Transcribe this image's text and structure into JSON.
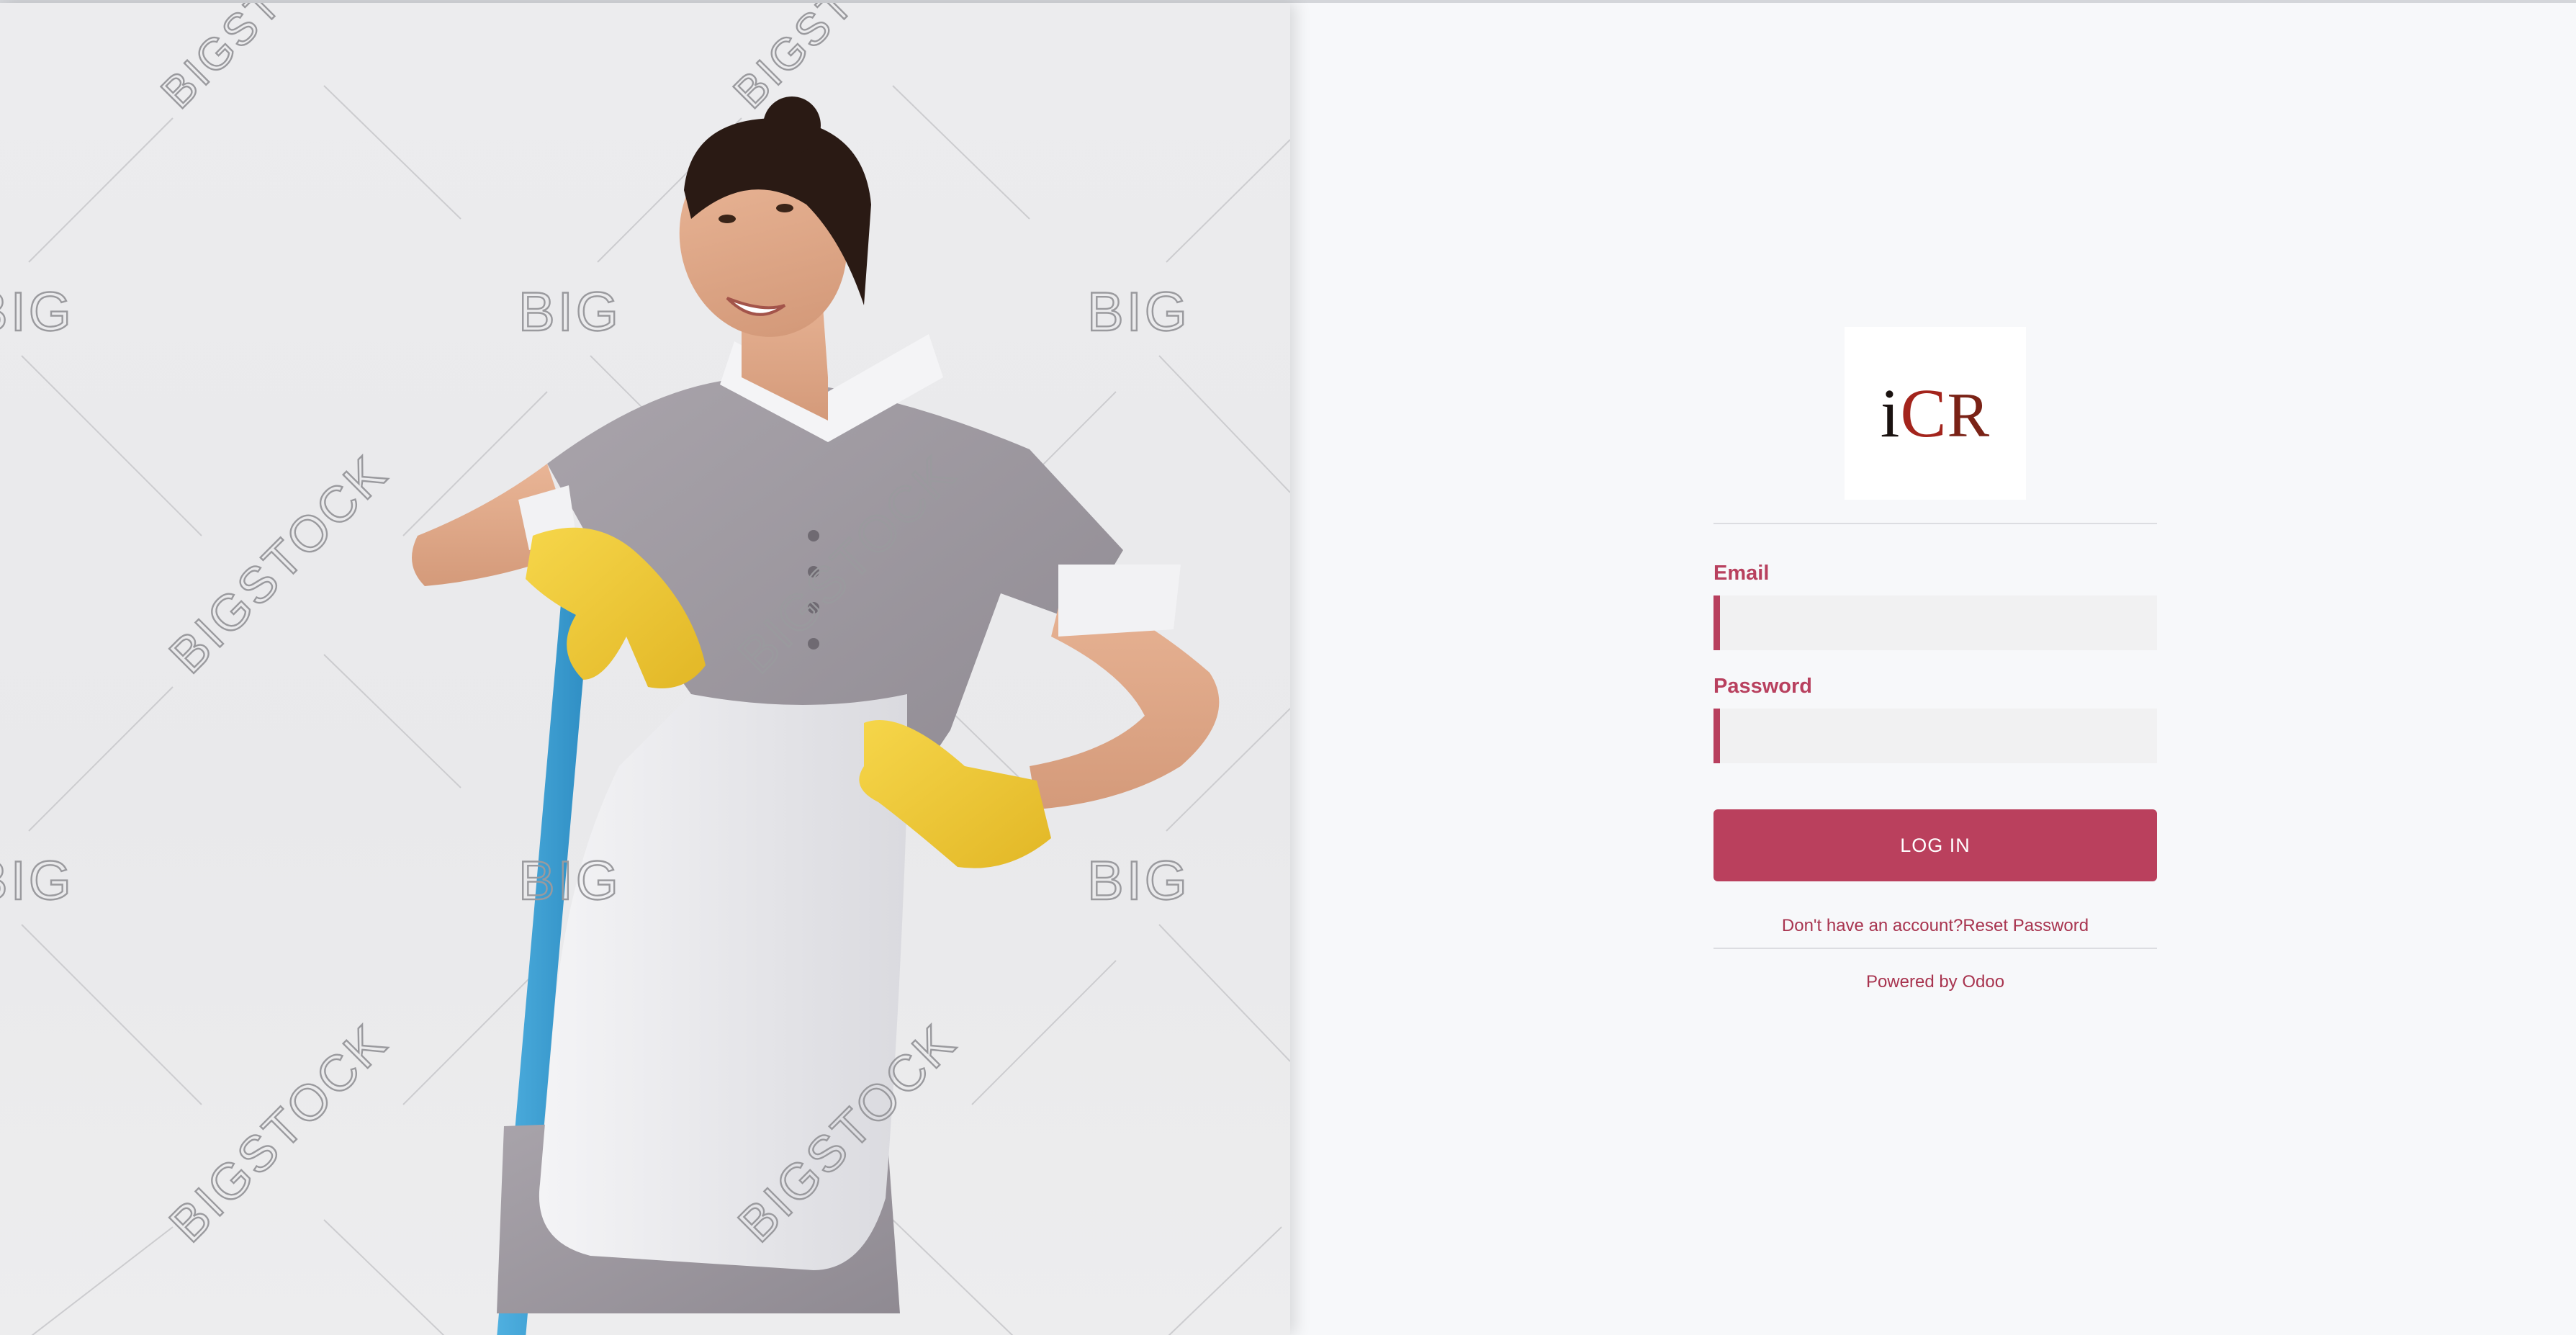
{
  "hero": {
    "watermark_brand": "BIGSTOCK",
    "watermark_short": "BIG",
    "image_subject": "smiling housekeeper in grey uniform with white apron, yellow gloves and blue mop"
  },
  "logo": {
    "part_i": "i",
    "part_c": "C",
    "part_r": "R"
  },
  "form": {
    "email_label": "Email",
    "email_value": "",
    "password_label": "Password",
    "password_value": "",
    "login_button": "LOG IN"
  },
  "links": {
    "signup": "Don't have an account?",
    "reset_password": "Reset Password"
  },
  "footer": {
    "powered_prefix": "Powered by ",
    "powered_brand": "Odoo"
  },
  "colors": {
    "accent": "#ba405d",
    "panel_bg": "#f7f8fa",
    "input_bg": "#f1f1f2",
    "logo_dark": "#1a1210",
    "logo_red": "#a3241c"
  }
}
